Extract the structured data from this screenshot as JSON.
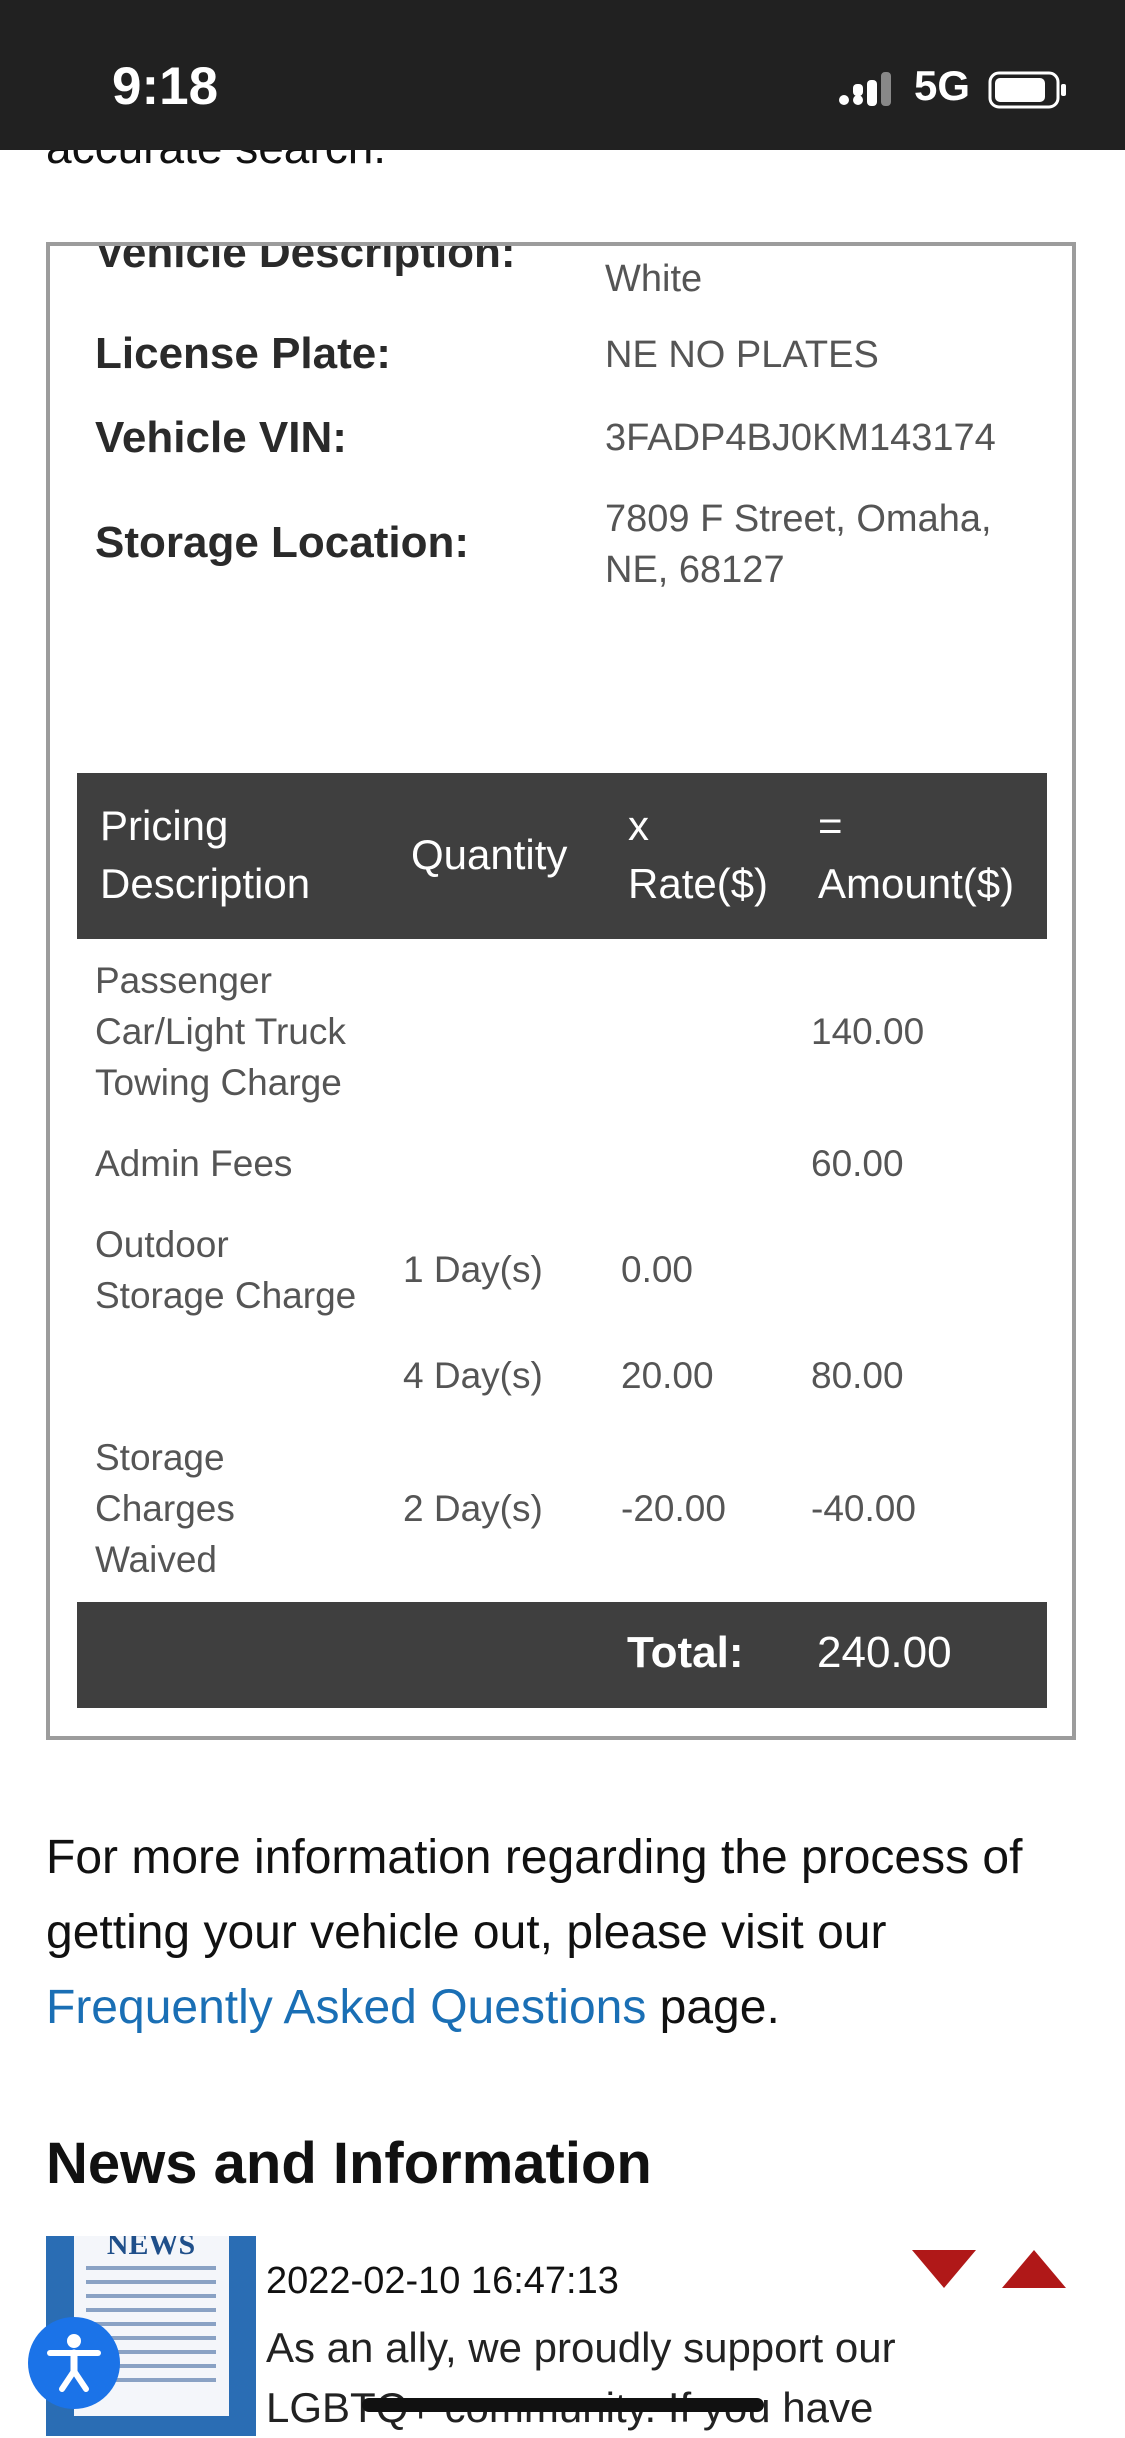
{
  "status_bar": {
    "time": "9:18",
    "network": "5G"
  },
  "intro": {
    "text": "accurate search."
  },
  "vehicle": {
    "description_label": "Vehicle Description:",
    "description_value": "White",
    "plate_label": "License Plate:",
    "plate_value": "NE NO PLATES",
    "vin_label": "Vehicle VIN:",
    "vin_value": "3FADP4BJ0KM143174",
    "storage_label": "Storage Location:",
    "storage_line1": "7809 F Street, Omaha,",
    "storage_line2": "NE, 68127"
  },
  "pricing": {
    "headers": {
      "desc_1": "Pricing",
      "desc_2": "Description",
      "qty": "Quantity",
      "rate_1": "x",
      "rate_2": "Rate($)",
      "amount_1": "=",
      "amount_2": "Amount($)"
    },
    "rows": [
      {
        "desc": [
          "Passenger",
          "Car/Light Truck",
          "Towing Charge"
        ],
        "qty": "",
        "rate": "",
        "amount": "140.00"
      },
      {
        "desc": [
          "Admin Fees"
        ],
        "qty": "",
        "rate": "",
        "amount": "60.00"
      },
      {
        "desc": [
          "Outdoor",
          "Storage Charge"
        ],
        "qty": "1 Day(s)",
        "rate": "0.00",
        "amount": ""
      },
      {
        "desc": [],
        "qty": "4 Day(s)",
        "rate": "20.00",
        "amount": "80.00"
      },
      {
        "desc": [
          "Storage",
          "Charges",
          "Waived"
        ],
        "qty": "2 Day(s)",
        "rate": "-20.00",
        "amount": "-40.00"
      }
    ],
    "total_label": "Total:",
    "total_value": "240.00"
  },
  "info": {
    "before_link": "For more information regarding the process of getting your vehicle out, please visit our ",
    "link_text": "Frequently Asked Questions",
    "after_link": " page."
  },
  "news": {
    "heading": "News and Information",
    "thumb_text": "NEWS",
    "item_date": "2022-02-10 16:47:13",
    "item_text": "As an ally, we proudly support our LGBTQ+ community. If you have"
  },
  "colors": {
    "header_bg": "#3f3f3f",
    "link": "#1a6fb5",
    "arrow": "#b01818",
    "a11y": "#1b73e8"
  },
  "icons": {
    "scroll_down": "arrow-down-icon",
    "scroll_up": "arrow-up-icon",
    "accessibility": "accessibility-icon"
  }
}
